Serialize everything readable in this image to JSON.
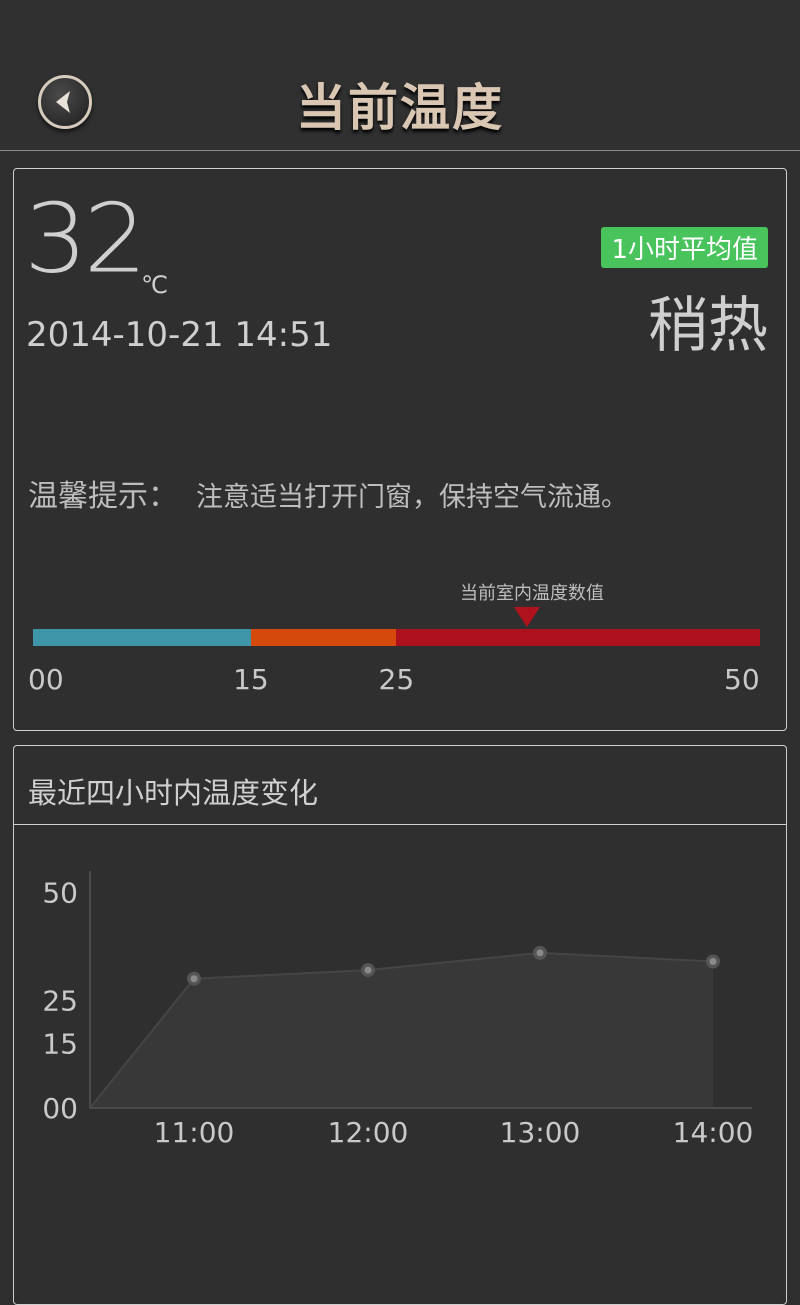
{
  "header": {
    "title": "当前温度",
    "back_icon": "back-arrow-icon"
  },
  "current": {
    "temperature": "32",
    "unit": "℃",
    "datetime": "2014-10-21 14:51",
    "badge": "1小时平均值",
    "status": "稍热"
  },
  "tip": {
    "label": "温馨提示：",
    "text": "注意适当打开门窗，保持空气流通。"
  },
  "scale": {
    "indicator_label": "当前室内温度数值",
    "value": 34,
    "min": 0,
    "max": 50,
    "segments": [
      {
        "from": 0,
        "to": 15,
        "color": "#3f95a8"
      },
      {
        "from": 15,
        "to": 25,
        "color": "#d6490c"
      },
      {
        "from": 25,
        "to": 50,
        "color": "#ad111d"
      }
    ],
    "ticks": [
      {
        "value": 0,
        "label": "00"
      },
      {
        "value": 15,
        "label": "15"
      },
      {
        "value": 25,
        "label": "25"
      },
      {
        "value": 50,
        "label": "50"
      }
    ]
  },
  "history": {
    "title": "最近四小时内温度变化"
  },
  "chart_data": {
    "type": "area",
    "title": "",
    "xlabel": "",
    "ylabel": "",
    "x": [
      "",
      "11:00",
      "12:00",
      "13:00",
      "14:00"
    ],
    "values": [
      0,
      30,
      32,
      36,
      34
    ],
    "yticks": [
      {
        "value": 0,
        "label": "00"
      },
      {
        "value": 15,
        "label": "15"
      },
      {
        "value": 25,
        "label": "25"
      },
      {
        "value": 50,
        "label": "50"
      }
    ],
    "ylim": [
      0,
      55
    ],
    "grid": false,
    "fill_color": "#383838",
    "line_color": "#454545",
    "point_color": "#8a8a8a"
  }
}
